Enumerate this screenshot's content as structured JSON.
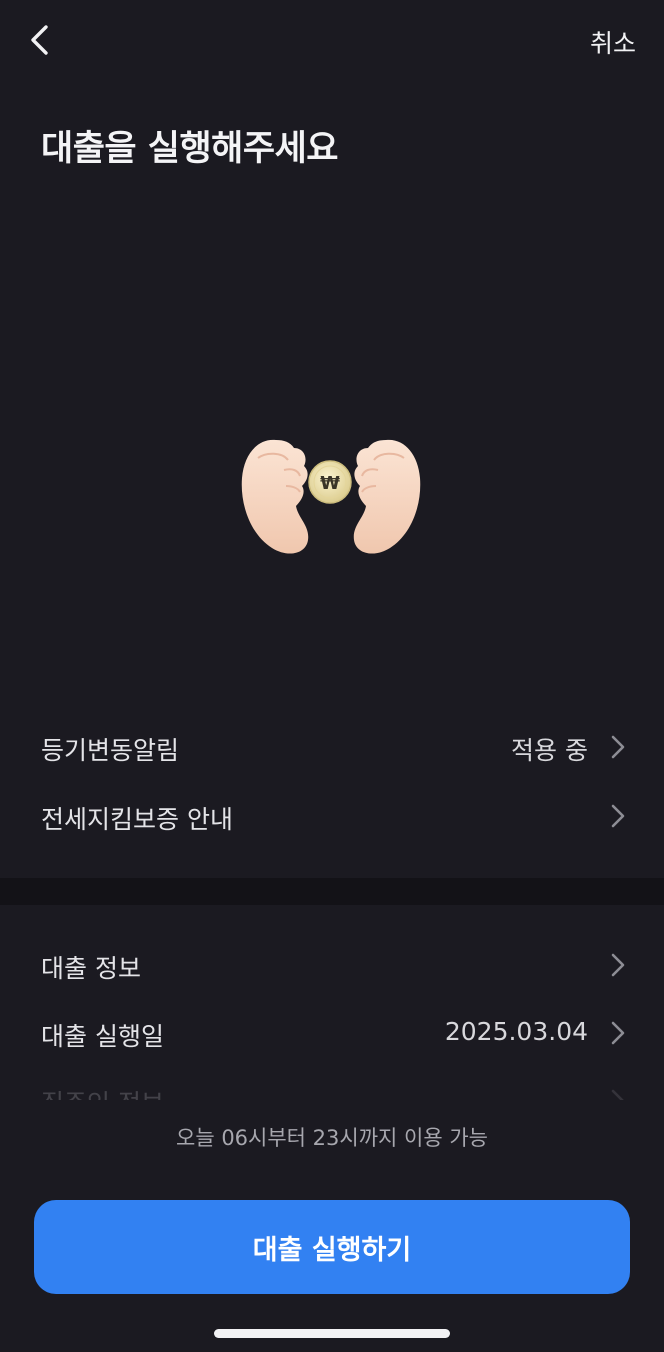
{
  "header": {
    "back_icon": "chevron-left-icon",
    "cancel_label": "취소"
  },
  "title": "대출을 실행해주세요",
  "illustration": {
    "icon": "hands-holding-coin-icon",
    "coin_symbol": "₩"
  },
  "notice_rows": [
    {
      "label": "등기변동알림",
      "value": "적용 중"
    },
    {
      "label": "전세지킴보증 안내",
      "value": ""
    }
  ],
  "detail_rows": [
    {
      "label": "대출 정보",
      "value": ""
    },
    {
      "label": "대출 실행일",
      "value": "2025.03.04"
    },
    {
      "label": "집주인 정보",
      "value": ""
    }
  ],
  "availability_note": "오늘 06시부터 23시까지 이용 가능",
  "cta": {
    "label": "대출 실행하기"
  },
  "colors": {
    "background": "#1b1a21",
    "divider": "#131217",
    "accent": "#3281f2",
    "coin": "#efe3b2"
  }
}
